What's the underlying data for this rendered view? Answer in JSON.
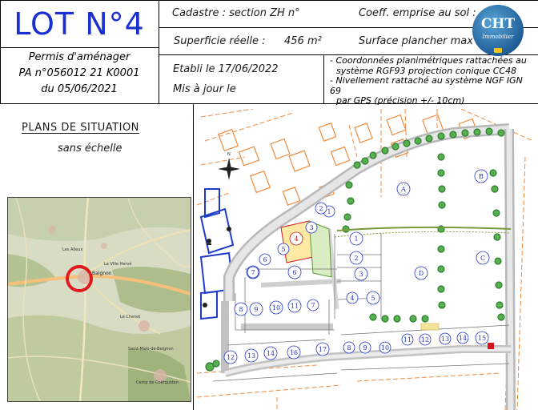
{
  "header": {
    "lot_title": "LOT N°4",
    "permis_line1": "Permis d'aménager",
    "permis_line2": "PA n°056012 21 K0001",
    "permis_line3": "du 05/06/2021",
    "cadastre": "Cadastre :  section ZH n°",
    "coefficient": "Coeff. emprise au sol :",
    "superficie_label": "Superficie réelle :",
    "superficie_value": "456 m²",
    "surface_plancher": "Surface plancher max :",
    "etabli": "Etabli le 17/06/2022",
    "mis_a_jour": "Mis à jour le",
    "note_line1": "- Coordonnées planimétriques rattachées au",
    "note_line2": "  système RGF93 projection conique CC48",
    "note_line3": "- Nivellement rattaché au système NGF IGN 69",
    "note_line4": "  par GPS (précision +/- 10cm)"
  },
  "logo": {
    "big": "CHT",
    "small": "Immobilier",
    "color": "#1f5e96"
  },
  "situation": {
    "title": "PLANS DE SITUATION",
    "subtitle": "sans échelle"
  },
  "location_map": {
    "place_labels": [
      "Baignon",
      "Les Alleux",
      "Le Chenot",
      "La Ville Hervé",
      "Saint-Malo-de-Beignon",
      "Camp de Coëtquidan"
    ],
    "marker_color": "#e0191e"
  },
  "site_plan": {
    "lot_numbers": [
      "1",
      "2",
      "3",
      "4",
      "5",
      "6",
      "7",
      "8",
      "9",
      "10",
      "11",
      "12",
      "13",
      "14",
      "15",
      "16",
      "17"
    ],
    "block_letters": [
      "A",
      "B",
      "C",
      "D"
    ],
    "highlight_lot": "4",
    "lot_number_color": "#2638c8",
    "highlight_color": "#d4141c"
  }
}
